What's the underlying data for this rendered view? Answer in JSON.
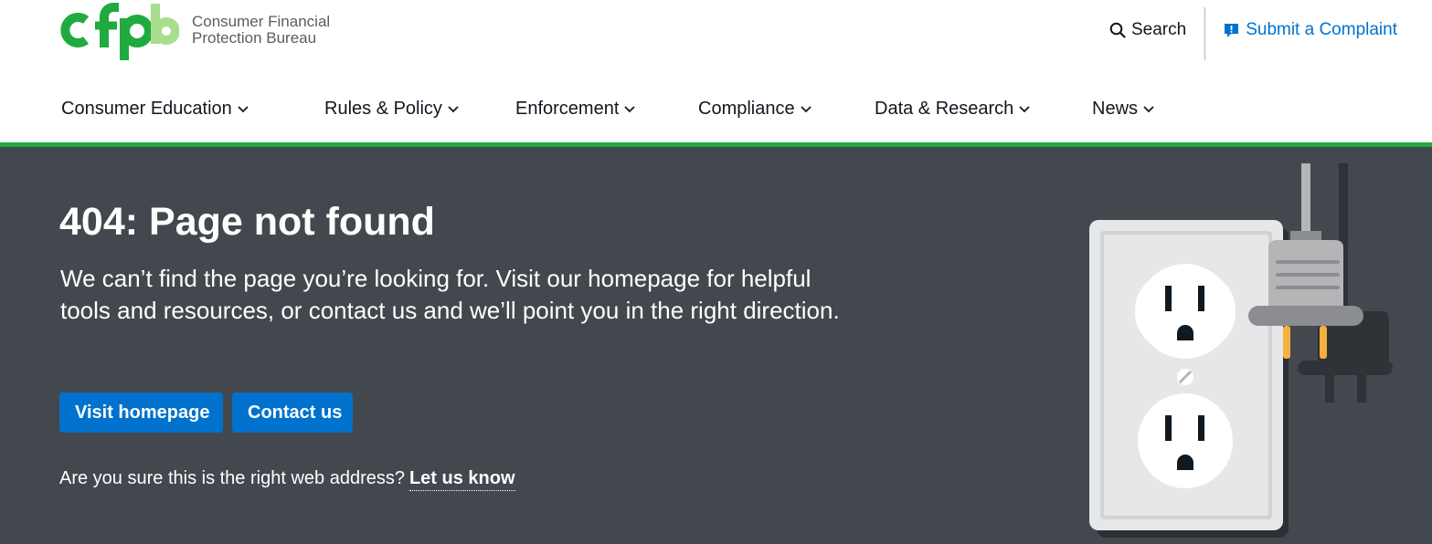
{
  "logo": {
    "mark": "cfpb",
    "line1": "Consumer Financial",
    "line2": "Protection Bureau"
  },
  "utility": {
    "search_label": "Search",
    "complaint_label": "Submit a Complaint"
  },
  "nav": {
    "items": [
      {
        "label": "Consumer Education"
      },
      {
        "label": "Rules & Policy"
      },
      {
        "label": "Enforcement"
      },
      {
        "label": "Compliance"
      },
      {
        "label": "Data & Research"
      },
      {
        "label": "News"
      }
    ]
  },
  "hero": {
    "title": "404: Page not found",
    "lead": "We can’t find the page you’re looking for. Visit our homepage for helpful tools and resources, or contact us and we’ll point you in the right direction.",
    "visit_label": "Visit homepage",
    "contact_label": "Contact us",
    "question": "Are you sure this is the right web address?",
    "let_us_know": "Let us know"
  },
  "colors": {
    "brand_green": "#20aa3f",
    "link_blue": "#0072ce",
    "hero_bg": "#43484e"
  },
  "icons": {
    "search": "search-icon",
    "complaint": "complaint-bubble-icon",
    "chevron": "chevron-down-icon",
    "illustration": "outlet-plug-illustration"
  }
}
